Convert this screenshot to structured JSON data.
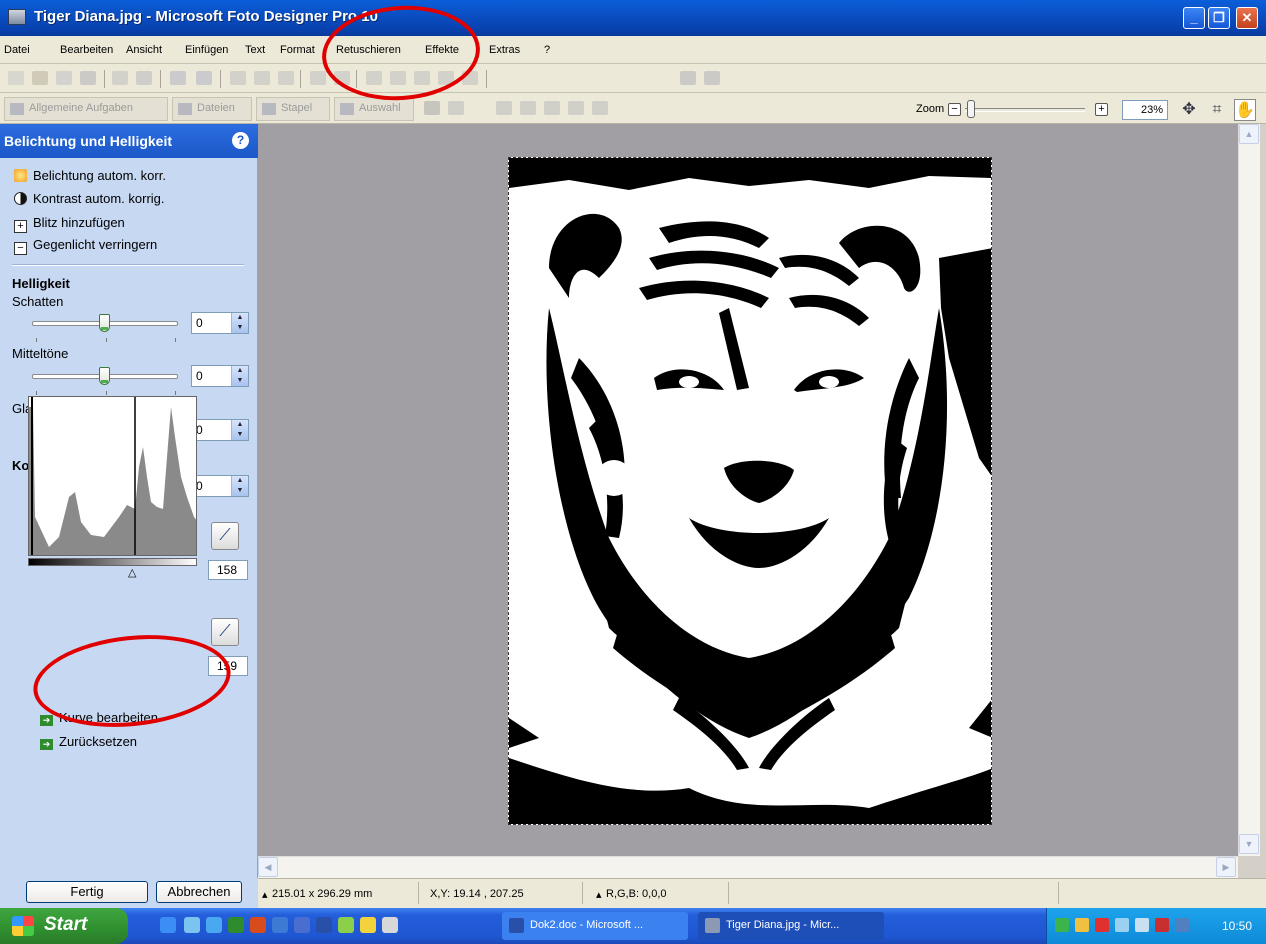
{
  "window": {
    "title": "Tiger Diana.jpg - Microsoft Foto Designer Pro 10",
    "minimize": "_",
    "restore": "❐",
    "close": "✕"
  },
  "menu": [
    "Datei",
    "Bearbeiten",
    "Ansicht",
    "Einfügen",
    "Text",
    "Format",
    "Retuschieren",
    "Effekte",
    "Extras",
    "?"
  ],
  "tabs": [
    "Allgemeine Aufgaben",
    "Dateien",
    "Stapel",
    "Auswahl"
  ],
  "zoom": {
    "label": "Zoom",
    "minus": "−",
    "plus": "+",
    "value": "23%",
    "slider_level": 0.02
  },
  "panel": {
    "title": "Belichtung und Helligkeit",
    "help": "?",
    "links": [
      "Belichtung autom. korr.",
      "Kontrast autom. korrig.",
      "Blitz hinzufügen",
      "Gegenlicht verringern"
    ],
    "brightness_heading": "Helligkeit",
    "shadows_label": "Schatten",
    "shadows_value": "0",
    "midtones_label": "Mitteltöne",
    "midtones_value": "0",
    "highlights_label": "Glanzlichter",
    "highlights_value": "0",
    "contrast_heading": "Kontrast",
    "contrast_value": "0",
    "black_point": "158",
    "white_point": "159",
    "edit_curve": "Kurve bearbeiten",
    "reset": "Zurücksetzen",
    "done": "Fertig",
    "cancel": "Abbrechen"
  },
  "status": {
    "size": "215.01 x 296.29 mm",
    "xy": "X,Y: 19.14 , 207.25",
    "rgb": "R,G,B: 0,0,0"
  },
  "taskbar": {
    "start": "Start",
    "items": [
      "Dok2.doc - Microsoft ...",
      "Tiger Diana.jpg - Micr..."
    ],
    "clock": "10:50"
  },
  "colors": {
    "annotation": "#e00000",
    "titlebar": "#0a4fc4",
    "panel": "#c7d8f2"
  }
}
